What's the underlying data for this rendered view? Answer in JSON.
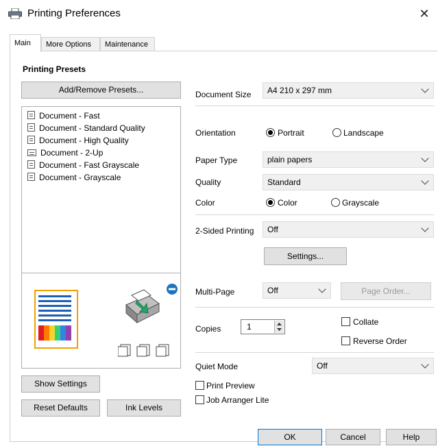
{
  "window": {
    "title": "Printing Preferences",
    "close_glyph": "✕"
  },
  "tabs": [
    {
      "label": "Main"
    },
    {
      "label": "More Options"
    },
    {
      "label": "Maintenance"
    }
  ],
  "presets": {
    "heading": "Printing Presets",
    "add_remove_button": "Add/Remove Presets...",
    "items": [
      {
        "label": "Document - Fast",
        "icon": "document-icon"
      },
      {
        "label": "Document - Standard Quality",
        "icon": "document-icon"
      },
      {
        "label": "Document - High Quality",
        "icon": "document-icon"
      },
      {
        "label": "Document - 2-Up",
        "icon": "two-up-icon"
      },
      {
        "label": "Document - Fast Grayscale",
        "icon": "document-icon"
      },
      {
        "label": "Document - Grayscale",
        "icon": "document-icon"
      }
    ]
  },
  "left_buttons": {
    "show_settings": "Show Settings",
    "reset_defaults": "Reset Defaults",
    "ink_levels": "Ink Levels"
  },
  "settings": {
    "document_size": {
      "label": "Document Size",
      "value": "A4 210 x 297 mm"
    },
    "orientation": {
      "label": "Orientation",
      "options": [
        "Portrait",
        "Landscape"
      ],
      "selected": "Portrait"
    },
    "paper_type": {
      "label": "Paper Type",
      "value": "plain papers"
    },
    "quality": {
      "label": "Quality",
      "value": "Standard"
    },
    "color": {
      "label": "Color",
      "options": [
        "Color",
        "Grayscale"
      ],
      "selected": "Color"
    },
    "two_sided": {
      "label": "2-Sided Printing",
      "value": "Off",
      "settings_button": "Settings..."
    },
    "multi_page": {
      "label": "Multi-Page",
      "value": "Off",
      "page_order_button": "Page Order..."
    },
    "copies": {
      "label": "Copies",
      "value": "1"
    },
    "collate": {
      "label": "Collate",
      "checked": false
    },
    "reverse_order": {
      "label": "Reverse Order",
      "checked": false
    },
    "quiet_mode": {
      "label": "Quiet Mode",
      "value": "Off"
    },
    "print_preview": {
      "label": "Print Preview",
      "checked": false
    },
    "job_arranger": {
      "label": "Job Arranger Lite",
      "checked": false
    }
  },
  "footer": {
    "ok": "OK",
    "cancel": "Cancel",
    "help": "Help"
  },
  "colors": {
    "accent": "#1e73be",
    "button_face": "#e1e1e1"
  }
}
